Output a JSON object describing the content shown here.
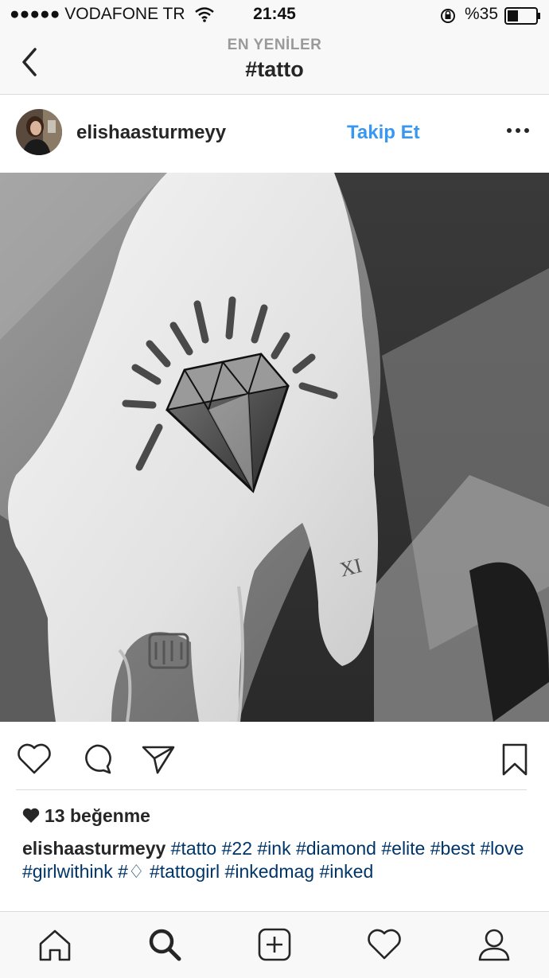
{
  "status_bar": {
    "carrier": "●●●●● VODAFONE TR",
    "time": "21:45",
    "battery": "%35"
  },
  "nav": {
    "subtitle": "EN YENİLER",
    "title": "#tatto"
  },
  "post": {
    "username": "elishaasturmeyy",
    "follow_label": "Takip Et",
    "likes": "13 beğenme",
    "caption_user": "elishaasturmeyy",
    "caption_tags": "#tatto #22 #ink #diamond #elite #best #love #girlwithink #♢ #tattogirl #inkedmag #inked"
  },
  "icons": {
    "back": "chevron-left-icon",
    "more": "more-horizontal-icon",
    "like": "heart-icon",
    "comment": "comment-icon",
    "share": "send-icon",
    "save": "bookmark-icon",
    "tabs": [
      "home-icon",
      "search-icon",
      "add-icon",
      "activity-icon",
      "profile-icon"
    ]
  },
  "colors": {
    "accent": "#3897f0",
    "hashtag": "#003569"
  }
}
